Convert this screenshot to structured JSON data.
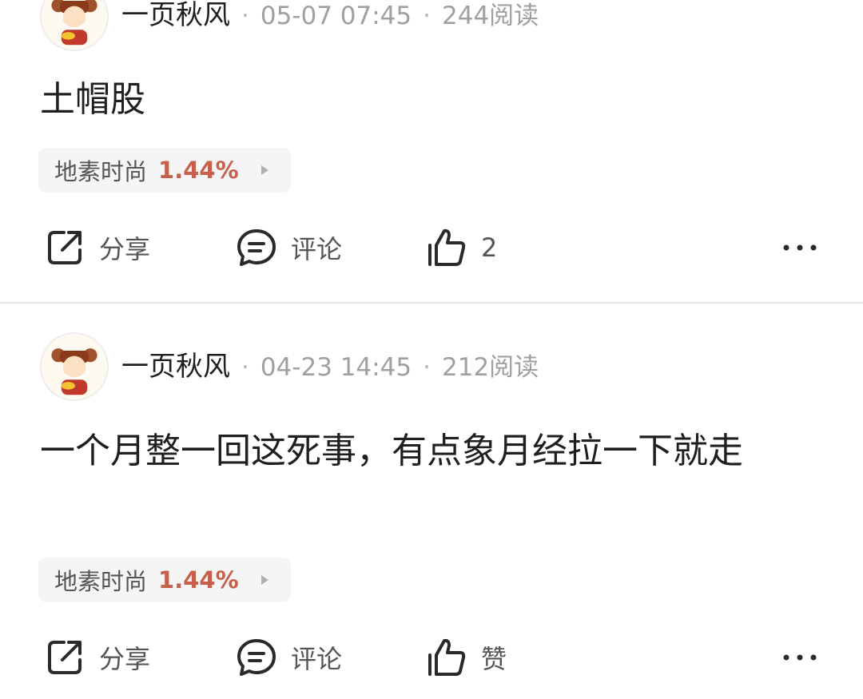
{
  "posts": [
    {
      "author": "一页秋风",
      "time": "05-07 07:45",
      "reads": "244阅读",
      "content": "土帽股",
      "stock": {
        "name": "地素时尚",
        "change": "1.44%"
      },
      "actions": {
        "share": "分享",
        "comment": "评论",
        "like": "2"
      }
    },
    {
      "author": "一页秋风",
      "time": "04-23 14:45",
      "reads": "212阅读",
      "content": "一个月整一回这死事，有点象月经拉一下就走",
      "stock": {
        "name": "地素时尚",
        "change": "1.44%"
      },
      "actions": {
        "share": "分享",
        "comment": "评论",
        "like": "赞"
      }
    }
  ],
  "colors": {
    "accent_change": "#c6604a",
    "divider": "#e6e6e6",
    "meta_text": "#a0a0a0"
  },
  "icons": [
    "avatar-caishen",
    "share-icon",
    "comment-icon",
    "thumbs-up-icon",
    "more-dots-icon",
    "chevron-right-icon"
  ]
}
